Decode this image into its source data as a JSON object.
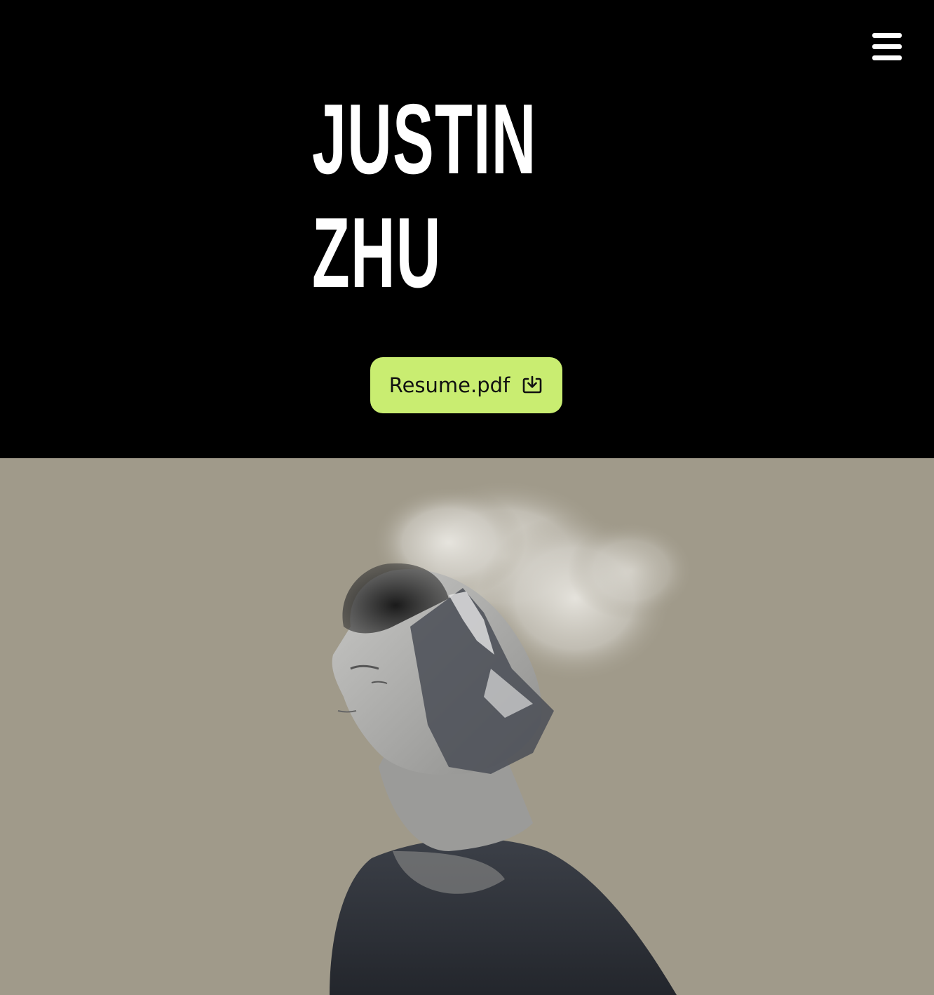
{
  "header": {
    "menu_icon": "hamburger-menu-icon"
  },
  "hero": {
    "name_line1": "JUSTIN",
    "name_line2": "ZHU",
    "resume_button_label": "Resume.pdf",
    "resume_icon": "download-icon",
    "accent_color": "#c9ed71"
  },
  "portrait": {
    "background_color": "#a09a8a"
  }
}
